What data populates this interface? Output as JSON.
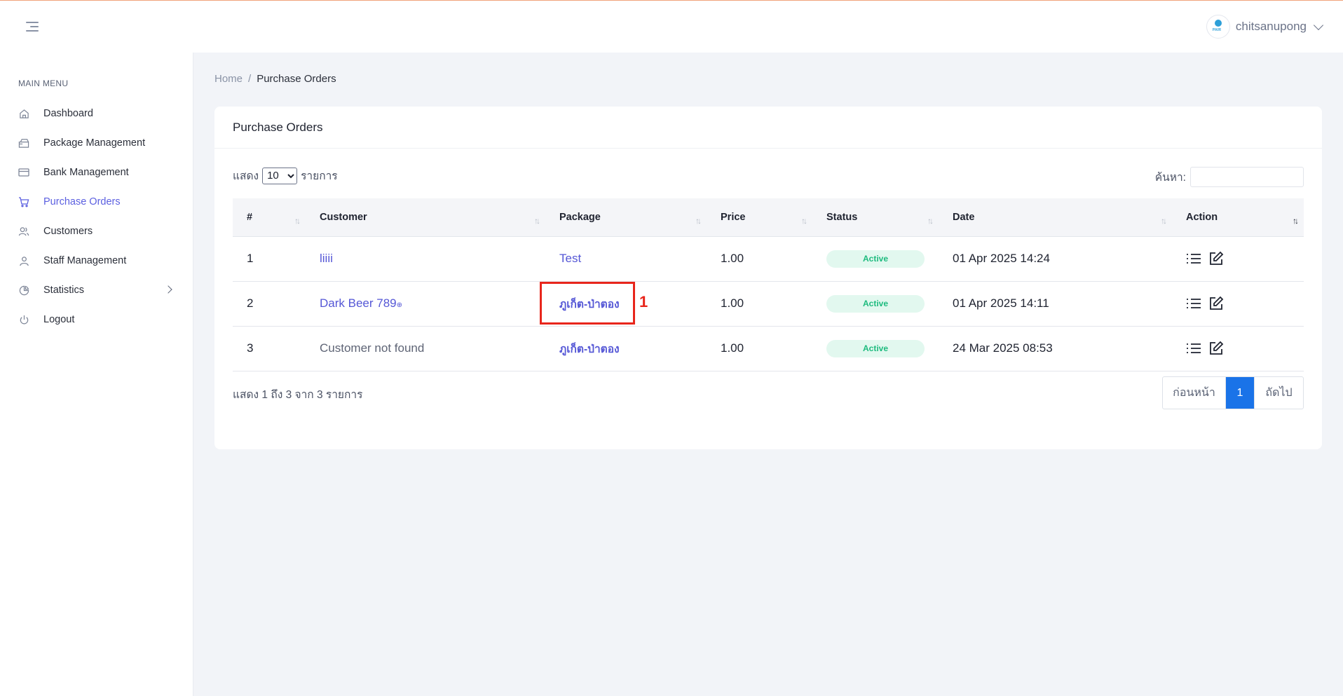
{
  "topbar": {
    "user_name": "chitsanupong",
    "logo_text": "PAIR"
  },
  "sidebar": {
    "heading": "MAIN MENU",
    "items": [
      {
        "label": "Dashboard",
        "icon": "home-icon"
      },
      {
        "label": "Package Management",
        "icon": "package-icon"
      },
      {
        "label": "Bank Management",
        "icon": "credit-card-icon"
      },
      {
        "label": "Purchase Orders",
        "icon": "shopping-cart-icon",
        "active": true
      },
      {
        "label": "Customers",
        "icon": "users-icon"
      },
      {
        "label": "Staff Management",
        "icon": "user-icon"
      },
      {
        "label": "Statistics",
        "icon": "pie-chart-icon"
      },
      {
        "label": "Logout",
        "icon": "power-icon"
      }
    ]
  },
  "breadcrumb": {
    "home": "Home",
    "separator": "/",
    "current": "Purchase Orders"
  },
  "card": {
    "title": "Purchase Orders",
    "length_prefix": "แสดง",
    "length_value": "10",
    "length_suffix": "รายการ",
    "search_label": "ค้นหา:",
    "columns": [
      "#",
      "Customer",
      "Package",
      "Price",
      "Status",
      "Date",
      "Action"
    ],
    "rows": [
      {
        "no": "1",
        "customer": "liiii",
        "package": "Test",
        "price": "1.00",
        "status": "Active",
        "date": "01 Apr 2025 14:24"
      },
      {
        "no": "2",
        "customer": "Dark Beer 789",
        "customer_suffix": "⊕",
        "package": "ภูเก็ต-ป่าตอง",
        "price": "1.00",
        "status": "Active",
        "date": "01 Apr 2025 14:11"
      },
      {
        "no": "3",
        "customer": "Customer not found",
        "package": "ภูเก็ต-ป่าตอง",
        "price": "1.00",
        "status": "Active",
        "date": "24 Mar 2025 08:53"
      }
    ],
    "info": "แสดง 1 ถึง 3 จาก 3 รายการ",
    "pagination": {
      "prev": "ก่อนหน้า",
      "current": "1",
      "next": "ถัดไป"
    }
  },
  "annotation": {
    "label": "1",
    "color": "#e8261c"
  },
  "colors": {
    "accent": "#5b5fe0",
    "primary": "#1a73e8",
    "status_active_bg": "#e2f8ef",
    "status_active_text": "#1dbb7e"
  }
}
